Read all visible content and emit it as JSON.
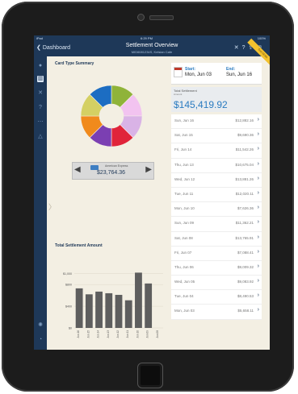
{
  "status": {
    "carrier": "iPad",
    "time": "6:29 PM",
    "battery": "100%"
  },
  "nav": {
    "back_label": "Dashboard",
    "title": "Settlement Overview",
    "subtitle": "MID6081234S, Kelsian Cafe",
    "icons": [
      "close-icon",
      "help-icon",
      "share-icon",
      "export-icon"
    ]
  },
  "ribbon": {
    "label": "Test Mode"
  },
  "sidebar": {
    "items": [
      "microphone-icon",
      "chart-icon",
      "tools-icon",
      "question-icon",
      "more-icon",
      "alert-icon",
      "settings-icon",
      "logout-icon"
    ]
  },
  "summary": {
    "title": "Card Type Summary",
    "selected_card": "American Express",
    "selected_value": "$23,764.36",
    "slices": [
      {
        "value": 1,
        "color": "#8fb339"
      },
      {
        "value": 1,
        "color": "#f2c3f0"
      },
      {
        "value": 1,
        "color": "#d9b3e6"
      },
      {
        "value": 1,
        "color": "#e0243a"
      },
      {
        "value": 1,
        "color": "#7b3fb2"
      },
      {
        "value": 1,
        "color": "#f08a1c"
      },
      {
        "value": 1,
        "color": "#d4d063"
      },
      {
        "value": 1,
        "color": "#1c6dc2"
      }
    ]
  },
  "chart_data": {
    "type": "bar",
    "title": "Total Settlement Amount",
    "categories": [
      "Jun 16",
      "Jun 15",
      "Jun 14",
      "Jun 13",
      "Jun 12",
      "Jun 11",
      "Jun 10",
      "Jun 09",
      "Jun 08"
    ],
    "values": [
      730,
      620,
      670,
      640,
      610,
      510,
      1020,
      820,
      0
    ],
    "yticks": [
      "$1,000",
      "$800",
      "$400",
      "$0"
    ],
    "ylim": [
      0,
      1100
    ],
    "bar_color": "#5e5e5e"
  },
  "range": {
    "start_label": "Start:",
    "start_value": "Mon, Jun 03",
    "end_label": "End:",
    "end_value": "Sun, Jun 16"
  },
  "total": {
    "label": "Total Settlement",
    "sublabel": "Amount",
    "value": "$145,419.92"
  },
  "settlements": [
    {
      "date": "Sun, Jun 16",
      "amount": "$12,882.16"
    },
    {
      "date": "Sat, Jun 15",
      "amount": "$9,690.36"
    },
    {
      "date": "Fri, Jun 14",
      "amount": "$11,542.26"
    },
    {
      "date": "Thu, Jun 13",
      "amount": "$10,675.04"
    },
    {
      "date": "Wed, Jun 12",
      "amount": "$13,881.26"
    },
    {
      "date": "Tue, Jun 11",
      "amount": "$12,020.11"
    },
    {
      "date": "Mon, Jun 10",
      "amount": "$7,626.36"
    },
    {
      "date": "Sun, Jun 09",
      "amount": "$11,362.21"
    },
    {
      "date": "Sat, Jun 08",
      "amount": "$13,765.91"
    },
    {
      "date": "Fri, Jun 07",
      "amount": "$7,088.41"
    },
    {
      "date": "Thu, Jun 06",
      "amount": "$9,009.32"
    },
    {
      "date": "Wed, Jun 05",
      "amount": "$9,083.92"
    },
    {
      "date": "Tue, Jun 04",
      "amount": "$8,490.53"
    },
    {
      "date": "Mon, Jun 03",
      "amount": "$5,658.11"
    }
  ]
}
